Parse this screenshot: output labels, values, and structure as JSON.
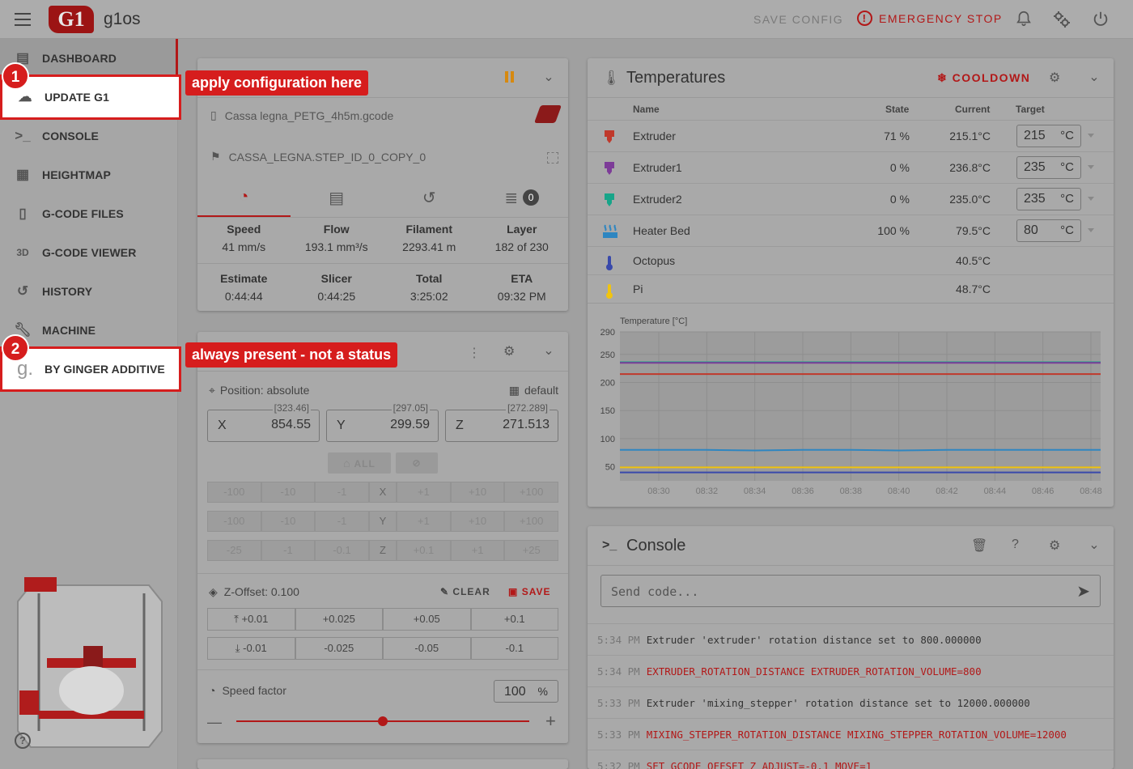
{
  "app": {
    "name": "g1os",
    "logo_text": "G1"
  },
  "topbar": {
    "save_config": "SAVE CONFIG",
    "emergency_stop": "EMERGENCY STOP"
  },
  "sidebar": {
    "items": [
      {
        "label": "DASHBOARD",
        "icon": "dashboard-icon"
      },
      {
        "label": "UPDATE G1",
        "icon": "cloud-download-icon"
      },
      {
        "label": "CONSOLE",
        "icon": "console-icon"
      },
      {
        "label": "HEIGHTMAP",
        "icon": "grid-icon"
      },
      {
        "label": "G-CODE FILES",
        "icon": "file-icon"
      },
      {
        "label": "G-CODE VIEWER",
        "icon": "3d-icon"
      },
      {
        "label": "HISTORY",
        "icon": "history-icon"
      },
      {
        "label": "MACHINE",
        "icon": "wrench-icon"
      },
      {
        "label": "BY GINGER ADDITIVE",
        "icon": "ginger-logo-icon"
      }
    ]
  },
  "annotations": [
    {
      "number": "1",
      "text": "apply configuration here"
    },
    {
      "number": "2",
      "text": "always present - not a status"
    }
  ],
  "status": {
    "file": "Cassa legna_PETG_4h5m.gcode",
    "object": "CASSA_LEGNA.STEP_ID_0_COPY_0",
    "queue_count": "0",
    "row1": [
      {
        "label": "Speed",
        "value": "41 mm/s"
      },
      {
        "label": "Flow",
        "value": "193.1 mm³/s"
      },
      {
        "label": "Filament",
        "value": "2293.41 m"
      },
      {
        "label": "Layer",
        "value": "182 of 230"
      }
    ],
    "row2": [
      {
        "label": "Estimate",
        "value": "0:44:44"
      },
      {
        "label": "Slicer",
        "value": "0:44:25"
      },
      {
        "label": "Total",
        "value": "3:25:02"
      },
      {
        "label": "ETA",
        "value": "09:32 PM"
      }
    ]
  },
  "toolhead": {
    "position_label": "Position: absolute",
    "profile": "default",
    "axes": [
      {
        "axis": "X",
        "value": "854.55",
        "target": "[323.46]"
      },
      {
        "axis": "Y",
        "value": "299.59",
        "target": "[297.05]"
      },
      {
        "axis": "Z",
        "value": "271.513",
        "target": "[272.289]"
      }
    ],
    "home_all": "ALL",
    "jog_xy": [
      "-100",
      "-10",
      "-1",
      "+1",
      "+10",
      "+100"
    ],
    "jog_z": [
      "-25",
      "-1",
      "-0.1",
      "+0.1",
      "+1",
      "+25"
    ],
    "zoffset_label": "Z-Offset: 0.100",
    "clear": "CLEAR",
    "save": "SAVE",
    "zoff_up": [
      "+0.01",
      "+0.025",
      "+0.05",
      "+0.1"
    ],
    "zoff_down": [
      "-0.01",
      "-0.025",
      "-0.05",
      "-0.1"
    ],
    "speed_factor_label": "Speed factor",
    "speed_factor_value": "100",
    "speed_factor_unit": "%",
    "speed_factor_fraction": 0.5
  },
  "temperatures": {
    "title": "Temperatures",
    "cooldown": "COOLDOWN",
    "headers": {
      "name": "Name",
      "state": "State",
      "current": "Current",
      "target": "Target"
    },
    "unit": "°C",
    "rows": [
      {
        "name": "Extruder",
        "state": "71 %",
        "current": "215.1°C",
        "target": "215",
        "color": "#c0392b"
      },
      {
        "name": "Extruder1",
        "state": "0 %",
        "current": "236.8°C",
        "target": "235",
        "color": "#7d3c98"
      },
      {
        "name": "Extruder2",
        "state": "0 %",
        "current": "235.0°C",
        "target": "235",
        "color": "#17a589"
      },
      {
        "name": "Heater Bed",
        "state": "100 %",
        "current": "79.5°C",
        "target": "80",
        "color": "#2e86c1"
      },
      {
        "name": "Octopus",
        "state": "",
        "current": "40.5°C",
        "target": "",
        "color": "#3949ab"
      },
      {
        "name": "Pi",
        "state": "",
        "current": "48.7°C",
        "target": "",
        "color": "#f1c40f"
      }
    ]
  },
  "chart_data": {
    "type": "line",
    "ylabel": "Temperature [°C]",
    "ylim": [
      25,
      290
    ],
    "yticks": [
      290,
      250,
      200,
      150,
      100,
      50
    ],
    "x": [
      "08:30",
      "08:32",
      "08:34",
      "08:36",
      "08:38",
      "08:40",
      "08:42",
      "08:44",
      "08:46",
      "08:48"
    ],
    "series": [
      {
        "color": "#17a589",
        "values": [
          236,
          236,
          236,
          236,
          236,
          236,
          236,
          236,
          236,
          236
        ]
      },
      {
        "color": "#7d3c98",
        "values": [
          235,
          235,
          235,
          235,
          235,
          235,
          235,
          235,
          235,
          235
        ]
      },
      {
        "color": "#c0392b",
        "values": [
          215,
          215,
          215,
          215,
          215,
          215,
          215,
          215,
          215,
          215
        ]
      },
      {
        "color": "#2e86c1",
        "values": [
          80,
          80,
          79,
          80,
          80,
          79,
          80,
          80,
          80,
          80
        ]
      },
      {
        "color": "#f1c40f",
        "values": [
          49,
          49,
          49,
          49,
          49,
          49,
          49,
          49,
          49,
          49
        ]
      },
      {
        "color": "#3949ab",
        "values": [
          40,
          40,
          40,
          40,
          40,
          40,
          40,
          40,
          40,
          40
        ]
      }
    ]
  },
  "console": {
    "title": "Console",
    "placeholder": "Send code...",
    "lines": [
      {
        "time": "5:34 PM",
        "text": "Extruder 'extruder' rotation distance set to 800.000000",
        "is_cmd": false
      },
      {
        "time": "5:34 PM",
        "text": "EXTRUDER_ROTATION_DISTANCE EXTRUDER_ROTATION_VOLUME=800",
        "is_cmd": true
      },
      {
        "time": "5:33 PM",
        "text": "Extruder 'mixing_stepper' rotation distance set to 12000.000000",
        "is_cmd": false
      },
      {
        "time": "5:33 PM",
        "text": "MIXING_STEPPER_ROTATION_DISTANCE MIXING_STEPPER_ROTATION_VOLUME=12000",
        "is_cmd": true
      },
      {
        "time": "5:32 PM",
        "text": "SET_GCODE_OFFSET Z_ADJUST=-0.1 MOVE=1",
        "is_cmd": true
      }
    ]
  }
}
